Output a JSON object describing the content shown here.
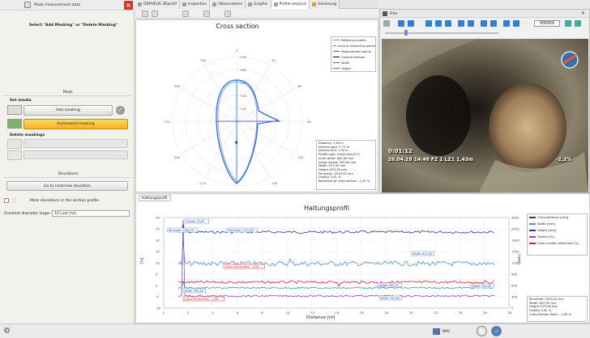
{
  "left_panel": {
    "title": "Mask measurement data",
    "instruction": "Select \"Add Masking\" or \"Delete Masking\"",
    "section_mask": "Mask",
    "set_masks_heading": "Set masks",
    "add_masking_label": "Add masking",
    "automated_masking_label": "Automated masking",
    "delete_maskings_heading": "Delete maskings",
    "delete_btn1_label": "",
    "delete_btn2_label": "",
    "deviations_heading": "Deviations",
    "next_deviation_label": "Go to next/new deviation",
    "mark_deviations_label": "Mark deviations in the section profile",
    "greatest_diameter_label": "Greatest diameter larger than:",
    "greatest_diameter_value": "10 Last mm"
  },
  "tabs": [
    {
      "label": "ORPHEUS 3Dprofil"
    },
    {
      "label": "Inspection"
    },
    {
      "label": "Observations"
    },
    {
      "label": "Graphic"
    },
    {
      "label": "Profile analysis"
    },
    {
      "label": "Sanierung"
    }
  ],
  "cross_section": {
    "title": "Cross section",
    "legend": [
      {
        "label": "Reference profile",
        "color": "#7aa6e8"
      },
      {
        "label": "curve of measuring points",
        "color": "#2d6fd6"
      },
      {
        "label": "Measurement points",
        "color": "#2d6fd6"
      },
      {
        "label": "Camera Position",
        "color": "#111111"
      },
      {
        "label": "Width",
        "color": "#8a4fd0"
      },
      {
        "label": "Height",
        "color": "#3a86d6"
      }
    ],
    "angle_labels": [
      "0",
      "30",
      "60",
      "90",
      "120",
      "150",
      "180",
      "210",
      "240",
      "270",
      "300",
      "330"
    ],
    "radial_labels": [
      "+500",
      "+400",
      "+300",
      "+200",
      "+100"
    ],
    "info": [
      "Distance: 1,84 m",
      "Interval start: 1,77 m",
      "Interval end: 1,92 m",
      "Profile type: Oviod form(2:1)",
      "Inner width: 600,00 mm",
      "Inside height: 900,00 mm",
      "Width: 621,95 mm",
      "Height: 879,26 mm",
      "Perimeter: 2345,52 mm",
      "Ovality: 2,61 %",
      "Reduction of cross section: -1,83 %"
    ]
  },
  "film": {
    "title": "Film",
    "counter": "000950",
    "time": "0:01:12",
    "overlay_text": "26.04.18 14:48 FZ 1   LZ1 1,43m",
    "value": "-2,2%"
  },
  "haltungsprofil": {
    "tab_label": "Haltungsprofil",
    "title": "Haltungsprofil",
    "xlabel": "Distance [m]",
    "ylabel_left": "[%]",
    "ylabel_right": "[mm]",
    "x_ticks": [
      "0",
      "2",
      "4",
      "6",
      "8",
      "10",
      "12",
      "14",
      "16",
      "18",
      "20",
      "22",
      "24",
      "26",
      "28"
    ],
    "y_left_ticks": [
      "30",
      "25",
      "20",
      "15",
      "10",
      "5",
      "0",
      "-5",
      "-10"
    ],
    "y_right_ticks": [
      "3000",
      "2400",
      "1800",
      "1500",
      "1200",
      "900",
      "600",
      "300",
      "0"
    ],
    "legend": [
      {
        "label": "Circumference [mm]",
        "color": "#2040a0"
      },
      {
        "label": "Width [mm]",
        "color": "#5a8ed8"
      },
      {
        "label": "Height [mm]",
        "color": "#2a3f9c"
      },
      {
        "label": "Ovality [%]",
        "color": "#8c4ad0"
      },
      {
        "label": "Cross section reduction [%]",
        "color": "#d8222a"
      }
    ],
    "annotations": [
      "Ovality: 24,81",
      "Perimeter: 2400,79",
      "Perimeter: 2377,83",
      "Width: 617,08",
      "Cross Section Red.: -1,58",
      "Height: 867,01",
      "Height: 894,99",
      "Width: 583,28",
      "Cross Section Red.: -1,58",
      "Width: 593,60"
    ],
    "info": [
      "Perimeter: 2345,52 mm",
      "Width: 621,95 mm",
      "Height: 879,26 mm",
      "Ovality: 2,61 %",
      "Cross Section Redd.: -1,83 %"
    ]
  },
  "bottom": {
    "status": "NRC"
  }
}
